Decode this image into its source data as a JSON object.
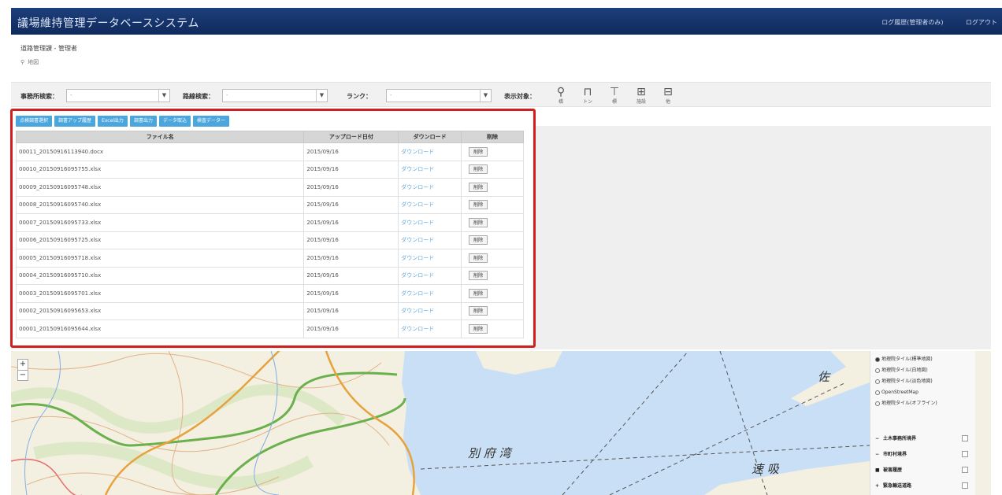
{
  "header": {
    "title": "議場維持管理データベースシステム",
    "user_info": "ログ履歴(管理者のみ)",
    "logout": "ログアウト"
  },
  "breadcrumb": {
    "path": "道路管理課 - 管理者",
    "sub": "地図"
  },
  "search": {
    "office_label": "事務所検索：",
    "office_value": "-",
    "road_label": "路線検索：",
    "road_value": "-",
    "rank_label": "ランク：",
    "rank_value": "-",
    "display_label": "表示対象：",
    "icons": [
      {
        "name": "bridge-icon",
        "glyph": "⚲",
        "caption": "橋"
      },
      {
        "name": "tunnel-icon",
        "glyph": "⊓",
        "caption": "トン"
      },
      {
        "name": "sign-icon",
        "glyph": "⊤",
        "caption": "標"
      },
      {
        "name": "facility-icon",
        "glyph": "⊞",
        "caption": "施設"
      },
      {
        "name": "other-icon",
        "glyph": "⊟",
        "caption": "他"
      }
    ]
  },
  "toolbar": {
    "buttons": [
      "点検調書選択",
      "調書アップ履歴",
      "Excel出力",
      "調書出力",
      "データ取込",
      "検査データ一"
    ]
  },
  "table": {
    "headers": {
      "filename": "ファイル名",
      "date": "アップロード日付",
      "download": "ダウンロード",
      "delete": "削除"
    },
    "download_label": "ダウンロード",
    "delete_label": "削除",
    "rows": [
      {
        "filename": "00011_20150916113940.docx",
        "date": "2015/09/16"
      },
      {
        "filename": "00010_20150916095755.xlsx",
        "date": "2015/09/16"
      },
      {
        "filename": "00009_20150916095748.xlsx",
        "date": "2015/09/16"
      },
      {
        "filename": "00008_20150916095740.xlsx",
        "date": "2015/09/16"
      },
      {
        "filename": "00007_20150916095733.xlsx",
        "date": "2015/09/16"
      },
      {
        "filename": "00006_20150916095725.xlsx",
        "date": "2015/09/16"
      },
      {
        "filename": "00005_20150916095718.xlsx",
        "date": "2015/09/16"
      },
      {
        "filename": "00004_20150916095710.xlsx",
        "date": "2015/09/16"
      },
      {
        "filename": "00003_20150916095701.xlsx",
        "date": "2015/09/16"
      },
      {
        "filename": "00002_20150916095653.xlsx",
        "date": "2015/09/16"
      },
      {
        "filename": "00001_20150916095644.xlsx",
        "date": "2015/09/16"
      }
    ]
  },
  "map": {
    "zoom_in": "+",
    "zoom_out": "−",
    "labels": {
      "bay": "別 府 湾",
      "strait": "速 吸",
      "sa": "佐"
    },
    "base_layers": [
      {
        "label": "地理院タイル(標準地図)",
        "selected": true
      },
      {
        "label": "地理院タイル(白地図)",
        "selected": false
      },
      {
        "label": "地理院タイル(淡色地図)",
        "selected": false
      },
      {
        "label": "OpenStreetMap",
        "selected": false
      },
      {
        "label": "地理院タイル(オフライン)",
        "selected": false
      }
    ],
    "overlays": [
      {
        "symbol": "−",
        "label": "土木事務所境界"
      },
      {
        "symbol": "−",
        "label": "市町村境界"
      },
      {
        "symbol": "■",
        "label": "被害履歴"
      },
      {
        "symbol": "+",
        "label": "緊急輸送道路"
      }
    ]
  }
}
